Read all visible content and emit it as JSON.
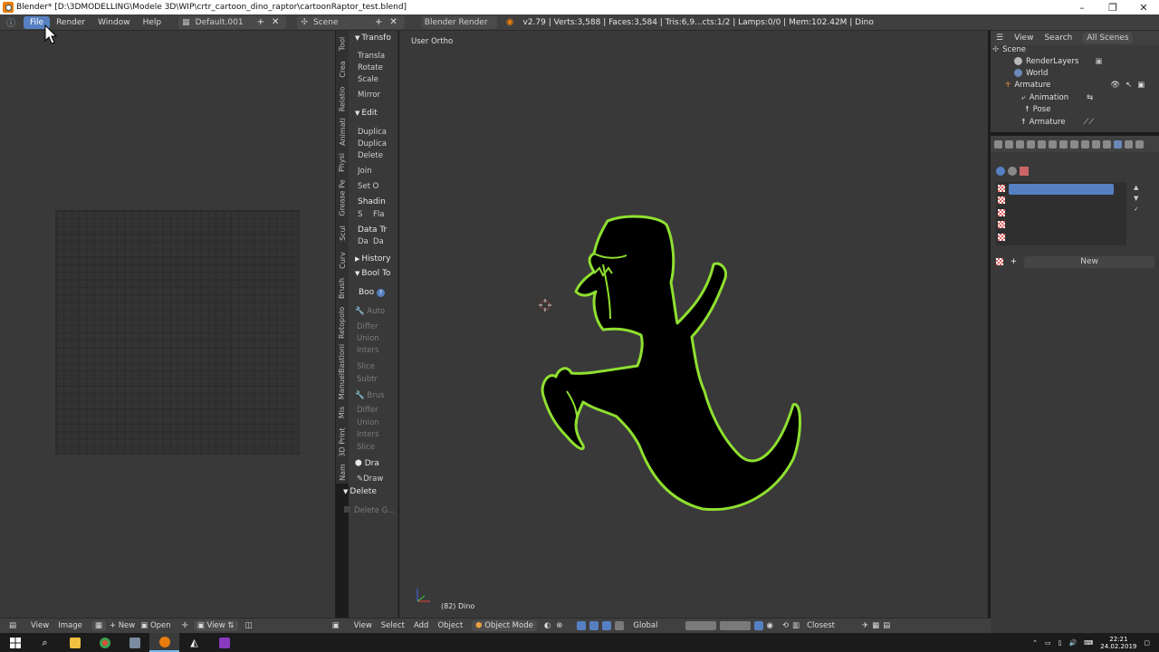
{
  "window": {
    "title": "Blender* [D:\\3DMODELLING\\Modele 3D\\WIP\\crtr_cartoon_dino_raptor\\cartoonRaptor_test.blend]",
    "minimize": "–",
    "maximize": "❐",
    "close": "✕"
  },
  "info_header": {
    "menus": [
      "File",
      "Render",
      "Window",
      "Help"
    ],
    "active_menu": "File",
    "screen_layout": "Default.001",
    "scene": "Scene",
    "render_engine": "Blender Render",
    "stats": "v2.79 | Verts:3,588 | Faces:3,584 | Tris:6,9...cts:1/2 | Lamps:0/0 | Mem:102.42M | Dino"
  },
  "tool_tabs": [
    "Tool",
    "Crea",
    "Relatio",
    "Animati",
    "Physi",
    "Grease Pe",
    "Scul",
    "Curv",
    "Brush",
    "Retopolo",
    "ManuelBastioni",
    "Mis",
    "3D Print",
    "Nam"
  ],
  "tool_shelf": {
    "transform_header": "Transfo",
    "translate": "Transla",
    "rotate": "Rotate",
    "scale": "Scale",
    "mirror": "Mirror",
    "edit_header": "Edit",
    "duplicate1": "Duplica",
    "duplicate2": "Duplica",
    "delete": "Delete",
    "join": "Join",
    "set_origin": "Set O",
    "shading": "Shadin",
    "shading_s": "S",
    "shading_f": "Fla",
    "data_transfer": "Data Tr",
    "data_da1": "Da",
    "data_da2": "Da",
    "history_header": "History",
    "booltool_header": "Bool To",
    "boo": "Boo",
    "auto": "Auto",
    "auto_difference": "Differ",
    "auto_union": "Union",
    "auto_intersect": "Inters",
    "auto_slice": "Slice",
    "auto_subtract": "Subtr",
    "brush": "Brus",
    "brush_difference": "Differ",
    "brush_union": "Union",
    "brush_intersect": "Inters",
    "brush_slice": "Slice",
    "draw_header": "Dra",
    "draw": "Draw",
    "delete_header": "Delete",
    "delete_g": "Delete G..."
  },
  "viewport": {
    "view_label": "User Ortho",
    "object_label": "(82) Dino",
    "outline_color": "#8fe030",
    "fill_color": "#000000"
  },
  "outliner": {
    "header": {
      "view": "View",
      "search": "Search",
      "scope": "All Scenes"
    },
    "rows": [
      "Scene",
      "RenderLayers",
      "World",
      "Armature",
      "Animation",
      "Pose",
      "Armature"
    ]
  },
  "properties": {
    "new_button": "New"
  },
  "bottom_left": {
    "view": "View",
    "image": "Image",
    "new": "New",
    "open": "Open",
    "view2": "View"
  },
  "bottom_viewport": {
    "view": "View",
    "select": "Select",
    "add": "Add",
    "object": "Object",
    "mode": "Object Mode",
    "orientation": "Global",
    "snap": "Closest"
  },
  "taskbar": {
    "time": "22:21",
    "date": "24.02.2019"
  },
  "colors": {
    "accent": "#5680c2",
    "panel": "#393939",
    "header": "#404040"
  }
}
